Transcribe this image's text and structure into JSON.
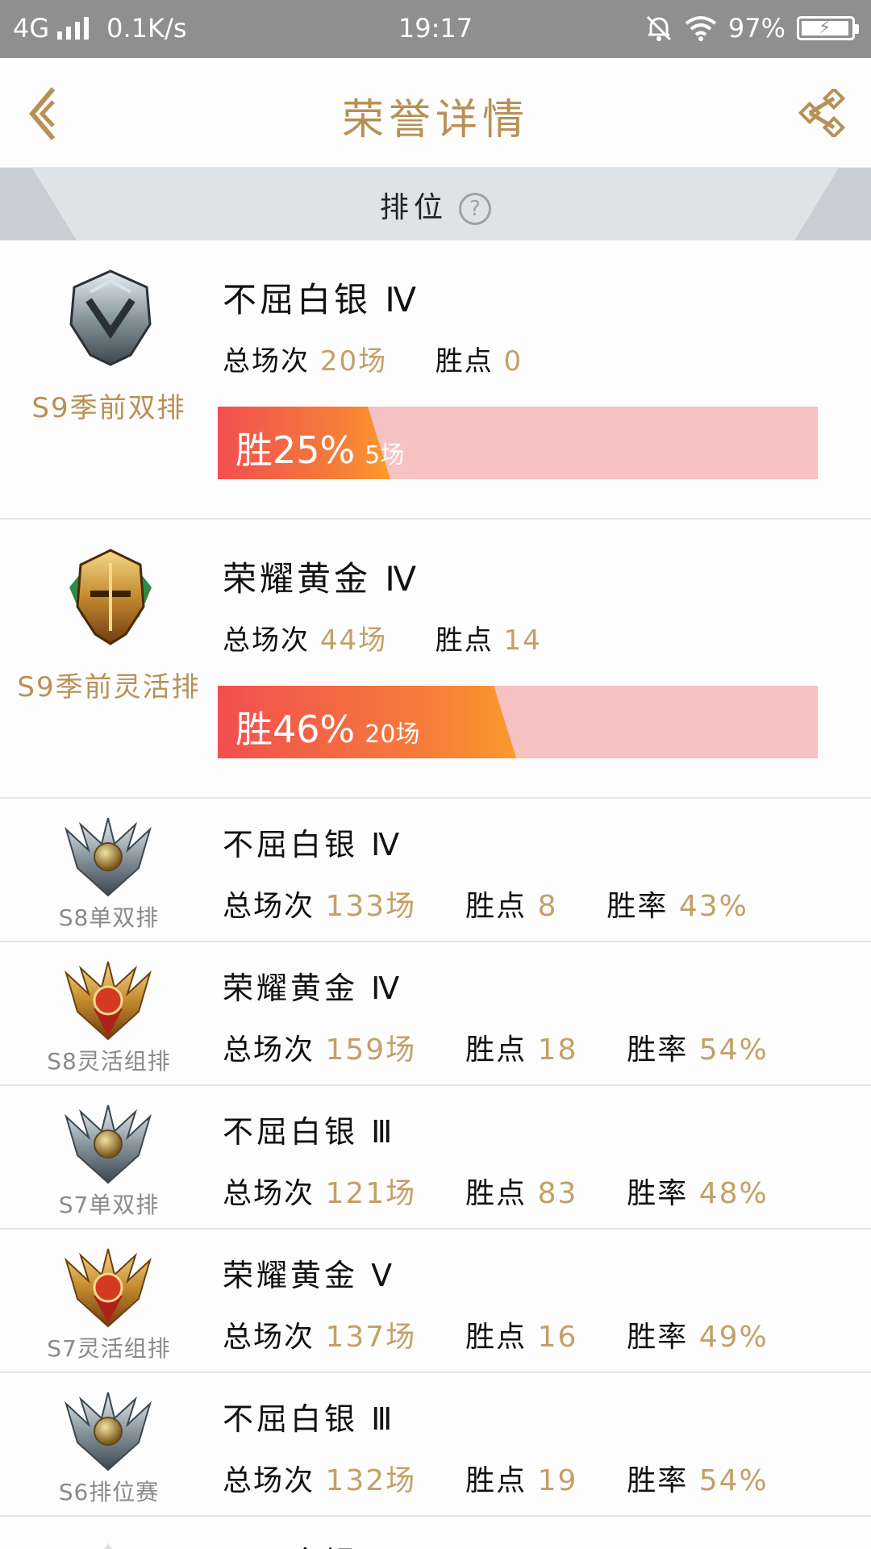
{
  "status_bar": {
    "network": "4G",
    "speed": "0.1K/s",
    "time": "19:17",
    "battery": "97%",
    "icons": [
      "signal-icon",
      "alarm-off-icon",
      "wifi-icon",
      "battery-charging-icon"
    ]
  },
  "header": {
    "title": "荣誉详情",
    "back_icon": "chevron-left-icon",
    "share_icon": "share-icon"
  },
  "section": {
    "label": "排位",
    "help_glyph": "?"
  },
  "labels": {
    "total": "总场次",
    "points": "胜点",
    "winrate": "胜率"
  },
  "featured": [
    {
      "queue": "S9季前双排",
      "rank": "不屈白银 Ⅳ",
      "total_games": "20场",
      "points": "0",
      "win_label": "胜25%",
      "wins": "5场",
      "win_fraction": 0.25,
      "emblem": "silver-emblem"
    },
    {
      "queue": "S9季前灵活排",
      "rank": "荣耀黄金 Ⅳ",
      "total_games": "44场",
      "points": "14",
      "win_label": "胜46%",
      "wins": "20场",
      "win_fraction": 0.46,
      "emblem": "gold-emblem"
    }
  ],
  "seasons": [
    {
      "queue": "S8单双排",
      "rank": "不屈白银 Ⅳ",
      "total_games": "133场",
      "points": "8",
      "winrate": "43%",
      "emblem": "silver-emblem"
    },
    {
      "queue": "S8灵活组排",
      "rank": "荣耀黄金 Ⅳ",
      "total_games": "159场",
      "points": "18",
      "winrate": "54%",
      "emblem": "gold-emblem"
    },
    {
      "queue": "S7单双排",
      "rank": "不屈白银 Ⅲ",
      "total_games": "121场",
      "points": "83",
      "winrate": "48%",
      "emblem": "silver-emblem"
    },
    {
      "queue": "S7灵活组排",
      "rank": "荣耀黄金 Ⅴ",
      "total_games": "137场",
      "points": "16",
      "winrate": "49%",
      "emblem": "gold-emblem"
    },
    {
      "queue": "S6排位赛",
      "rank": "不屈白银 Ⅲ",
      "total_games": "132场",
      "points": "19",
      "winrate": "54%",
      "emblem": "silver-emblem"
    }
  ],
  "colors": {
    "accent_gold": "#b89055",
    "value_gold": "#c3a067",
    "win_bar_start": "#f14f4f",
    "win_bar_end": "#fb9a2c",
    "win_bar_track": "#f8c2c3"
  }
}
